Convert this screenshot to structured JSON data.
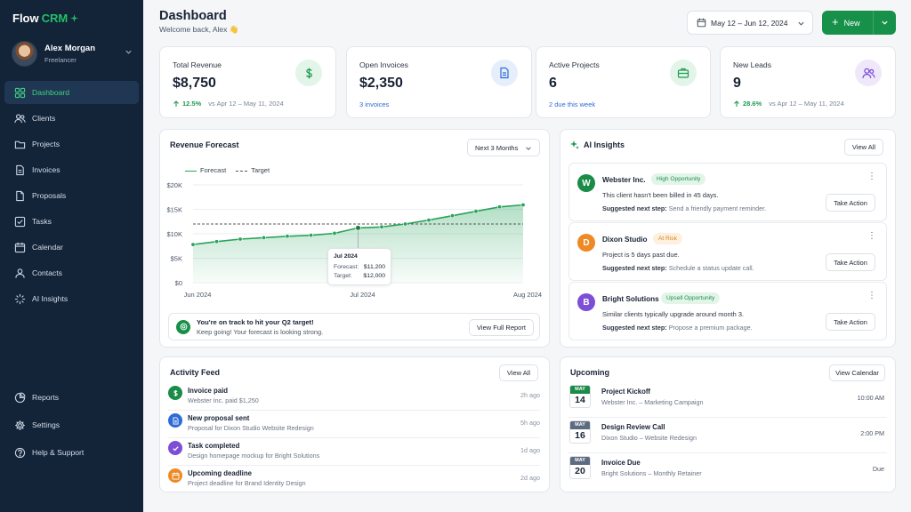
{
  "app": {
    "logo_a": "Flow",
    "logo_b": "CRM"
  },
  "profile": {
    "name": "Alex Morgan",
    "role": "Freelancer"
  },
  "sidebar": {
    "items": [
      {
        "label": "Dashboard",
        "icon": "grid-icon",
        "active": true
      },
      {
        "label": "Clients",
        "icon": "users-icon"
      },
      {
        "label": "Projects",
        "icon": "folder-icon"
      },
      {
        "label": "Invoices",
        "icon": "file-icon"
      },
      {
        "label": "Proposals",
        "icon": "document-icon"
      },
      {
        "label": "Tasks",
        "icon": "checkbox-icon"
      },
      {
        "label": "Calendar",
        "icon": "calendar-icon"
      },
      {
        "label": "Contacts",
        "icon": "contacts-icon"
      },
      {
        "label": "AI Insights",
        "icon": "sparkle-icon"
      }
    ],
    "bottom": [
      {
        "label": "Reports",
        "icon": "pie-icon"
      },
      {
        "label": "Settings",
        "icon": "gear-icon"
      },
      {
        "label": "Help & Support",
        "icon": "help-icon"
      }
    ]
  },
  "header": {
    "title": "Dashboard",
    "subtitle": "Welcome back, Alex 👋",
    "date_range": "May 12 – Jun 12, 2024",
    "new_label": "New"
  },
  "stats": [
    {
      "label": "Total Revenue",
      "value": "$8,750",
      "change": "12.5%",
      "compare": "vs Apr 12 – May 11, 2024",
      "icon": "dollar-icon",
      "color": "#1f9a52"
    },
    {
      "label": "Open Invoices",
      "value": "$2,350",
      "link": "3 invoices",
      "icon": "invoice-icon",
      "color": "#2e6bd8"
    },
    {
      "label": "Active Projects",
      "value": "6",
      "link": "2 due this week",
      "icon": "briefcase-icon",
      "color": "#1f9a52"
    },
    {
      "label": "New Leads",
      "value": "9",
      "change": "28.6%",
      "compare": "vs Apr 12 – May 11, 2024",
      "icon": "people-icon",
      "color": "#7c4fd6"
    }
  ],
  "forecast": {
    "title": "Revenue Forecast",
    "period": "Next 3 Months",
    "legend_forecast": "Forecast",
    "legend_target": "Target",
    "tooltip": {
      "title": "Jul 2024",
      "forecast_label": "Forecast:",
      "forecast_value": "$11,200",
      "target_label": "Target:",
      "target_value": "$12,000"
    },
    "banner_title": "You're on track to hit your Q2 target!",
    "banner_text": "Keep going! Your forecast is looking strong.",
    "banner_button": "View Full Report"
  },
  "chart_data": {
    "type": "area",
    "x": [
      "Jun 2024",
      "",
      "",
      "",
      "",
      "",
      "",
      "Jul 2024",
      "",
      "",
      "",
      "",
      "",
      "",
      "Aug 2024"
    ],
    "xticks": [
      "Jun 2024",
      "Jul 2024",
      "Aug 2024"
    ],
    "series": [
      {
        "name": "Forecast",
        "values": [
          7800,
          8400,
          8900,
          9200,
          9500,
          9700,
          10100,
          11200,
          11400,
          12000,
          12800,
          13700,
          14600,
          15500,
          15900
        ]
      },
      {
        "name": "Target",
        "values": [
          12000,
          12000,
          12000,
          12000,
          12000,
          12000,
          12000,
          12000,
          12000,
          12000,
          12000,
          12000,
          12000,
          12000,
          12000
        ]
      }
    ],
    "yticks": [
      "$0",
      "$5K",
      "$10K",
      "$15K",
      "$20K"
    ],
    "ylim": [
      0,
      20000
    ],
    "grid": true,
    "legend": "top-left"
  },
  "insights": {
    "title": "AI Insights",
    "view_all": "View All",
    "items": [
      {
        "initial": "W",
        "name": "Webster Inc.",
        "tag": "High Opportunity",
        "tag_bg": "#e3f5e9",
        "tag_fg": "#1f8f4c",
        "avatar": "#1a8c48",
        "desc": "This client hasn't been billed in 45 days.",
        "step_label": "Suggested next step:",
        "step": "Send a friendly payment reminder.",
        "action": "Take Action"
      },
      {
        "initial": "D",
        "name": "Dixon Studio",
        "tag": "At Risk",
        "tag_bg": "#fdf0de",
        "tag_fg": "#d4861b",
        "avatar": "#ee8a25",
        "desc": "Project is 5 days past due.",
        "step_label": "Suggested next step:",
        "step": "Schedule a status update call.",
        "action": "Take Action"
      },
      {
        "initial": "B",
        "name": "Bright Solutions",
        "tag": "Upsell Opportunity",
        "tag_bg": "#e3f5e9",
        "tag_fg": "#1f8f4c",
        "avatar": "#7c4fd6",
        "desc": "Similar clients typically upgrade around month 3.",
        "step_label": "Suggested next step:",
        "step": "Propose a premium package.",
        "action": "Take Action"
      }
    ]
  },
  "activity": {
    "title": "Activity Feed",
    "view_all": "View All",
    "items": [
      {
        "title": "Invoice paid",
        "desc": "Webster Inc. paid $1,250",
        "time": "2h ago",
        "icon": "dollar-icon",
        "color": "#1a8c48"
      },
      {
        "title": "New proposal sent",
        "desc": "Proposal for Dixon Studio Website Redesign",
        "time": "5h ago",
        "icon": "document-icon",
        "color": "#2e6bd8"
      },
      {
        "title": "Task completed",
        "desc": "Design homepage mockup for Bright Solutions",
        "time": "1d ago",
        "icon": "check-icon",
        "color": "#7c4fd6"
      },
      {
        "title": "Upcoming deadline",
        "desc": "Project deadline for Brand Identity Design",
        "time": "2d ago",
        "icon": "calendar-icon",
        "color": "#ee8a25"
      }
    ]
  },
  "upcoming": {
    "title": "Upcoming",
    "view_calendar": "View Calendar",
    "items": [
      {
        "month": "MAY",
        "day": "14",
        "title": "Project Kickoff",
        "desc": "Webster Inc. – Marketing Campaign",
        "time": "10:00 AM",
        "color": "#1a8c48"
      },
      {
        "month": "MAY",
        "day": "16",
        "title": "Design Review Call",
        "desc": "Dixon Studio – Website Redesign",
        "time": "2:00 PM",
        "color": "#5d6b80"
      },
      {
        "month": "MAY",
        "day": "20",
        "title": "Invoice Due",
        "desc": "Bright Solutions – Monthly Retainer",
        "time": "Due",
        "color": "#5d6b80"
      }
    ]
  }
}
